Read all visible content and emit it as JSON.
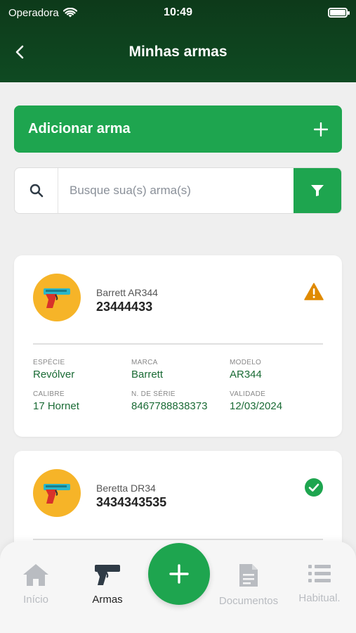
{
  "status_bar": {
    "carrier": "Operadora",
    "time": "10:49"
  },
  "header": {
    "title": "Minhas armas"
  },
  "add_button": {
    "label": "Adicionar arma"
  },
  "search": {
    "placeholder": "Busque sua(s) arma(s)",
    "value": ""
  },
  "weapons": [
    {
      "name": "Barrett AR344",
      "number": "23444433",
      "status_icon": "warning-icon",
      "details": [
        {
          "label": "ESPÉCIE",
          "value": "Revólver"
        },
        {
          "label": "MARCA",
          "value": "Barrett"
        },
        {
          "label": "MODELO",
          "value": "AR344"
        },
        {
          "label": "CALIBRE",
          "value": "17 Hornet"
        },
        {
          "label": "N. DE SÉRIE",
          "value": "8467788838373"
        },
        {
          "label": "VALIDADE",
          "value": "12/03/2024"
        }
      ]
    },
    {
      "name": "Beretta DR34",
      "number": "3434343535",
      "status_icon": "check-circle-icon"
    }
  ],
  "tabs": [
    {
      "label": "Início",
      "icon": "home-icon",
      "active": false
    },
    {
      "label": "Armas",
      "icon": "pistol-icon",
      "active": true
    },
    {
      "label": "Documentos",
      "icon": "document-icon",
      "active": false
    },
    {
      "label": "Habitual.",
      "icon": "list-icon",
      "active": false
    }
  ],
  "colors": {
    "header_bg": "#0f4a22",
    "accent_green": "#1ea54f",
    "warning": "#e08a00",
    "avatar_bg": "#f6b428"
  }
}
